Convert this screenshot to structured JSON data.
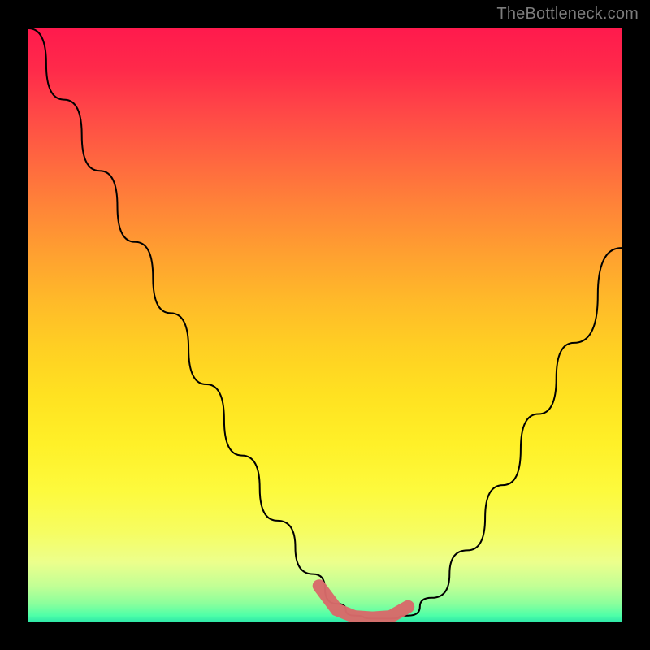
{
  "watermark": "TheBottleneck.com",
  "chart_data": {
    "type": "line",
    "title": "",
    "xlabel": "",
    "ylabel": "",
    "xlim": [
      0,
      100
    ],
    "ylim": [
      0,
      100
    ],
    "background_gradient": {
      "top_color": "#ff1a4d",
      "mid_color": "#ffe221",
      "bottom_color": "#30e8a8"
    },
    "series": [
      {
        "name": "bottleneck-curve",
        "type": "line",
        "x": [
          0,
          6,
          12,
          18,
          24,
          30,
          36,
          42,
          48,
          52,
          55,
          58,
          61,
          64,
          68,
          74,
          80,
          86,
          92,
          100
        ],
        "y": [
          100,
          88,
          76,
          64,
          52,
          40,
          28,
          17,
          8,
          3,
          1,
          0.5,
          0.5,
          1,
          4,
          12,
          23,
          35,
          47,
          63
        ]
      },
      {
        "name": "optimal-region-marker",
        "type": "marker",
        "x": [
          49,
          52,
          55,
          58,
          61,
          64
        ],
        "y": [
          6,
          2,
          0.8,
          0.6,
          0.8,
          2.5
        ]
      }
    ],
    "annotations": []
  }
}
